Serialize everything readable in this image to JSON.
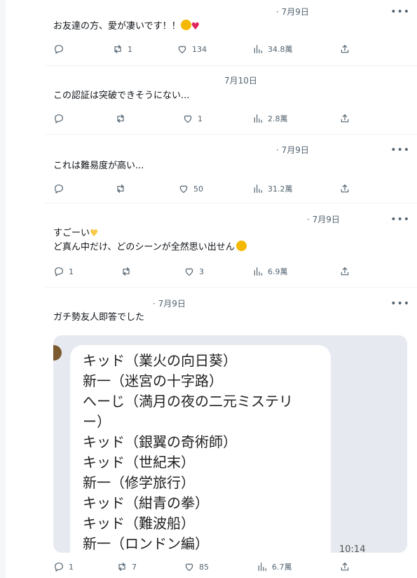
{
  "tweets": [
    {
      "date": "· 7月9日",
      "text": "お友達の方、愛が凄いです！！",
      "replies": "",
      "retweets": "1",
      "likes": "134",
      "views": "34.8萬"
    },
    {
      "date": "7月10日",
      "text": "この認証は突破できそうにない...",
      "replies": "",
      "retweets": "",
      "likes": "1",
      "views": "2.8萬"
    },
    {
      "date": "· 7月9日",
      "text": "これは難易度が高い...",
      "replies": "",
      "retweets": "",
      "likes": "50",
      "views": "31.2萬"
    },
    {
      "date": "· 7月9日",
      "line1": "すごーい",
      "line2": "ど真ん中だけ、どのシーンが全然思い出せん",
      "replies": "1",
      "retweets": "",
      "likes": "3",
      "views": "6.9萬"
    },
    {
      "date": "· 7月9日",
      "text": "ガチ勢友人即答でした",
      "image_lines": [
        "キッド（業火の向日葵）",
        "新一（迷宮の十字路）",
        "へーじ（満月の夜の二元ミステリ",
        "ー）",
        "キッド（銀翼の奇術師）",
        "キッド（世紀末）",
        "新一（修学旅行）",
        "キッド（紺青の拳）",
        "キッド（難波船）",
        "新一（ロンドン編）"
      ],
      "image_time": "10:14",
      "replies": "1",
      "retweets": "7",
      "likes": "85",
      "views": "6.7萬"
    }
  ],
  "icons": {
    "reply": "reply-icon",
    "retweet": "retweet-icon",
    "like": "heart-icon",
    "views": "views-icon",
    "share": "share-icon",
    "more": "more-icon"
  },
  "colors": {
    "muted": "#536471",
    "divider": "#eff3f4",
    "heart_emoji": "#e0245e",
    "yellow_heart": "#f7c948"
  }
}
